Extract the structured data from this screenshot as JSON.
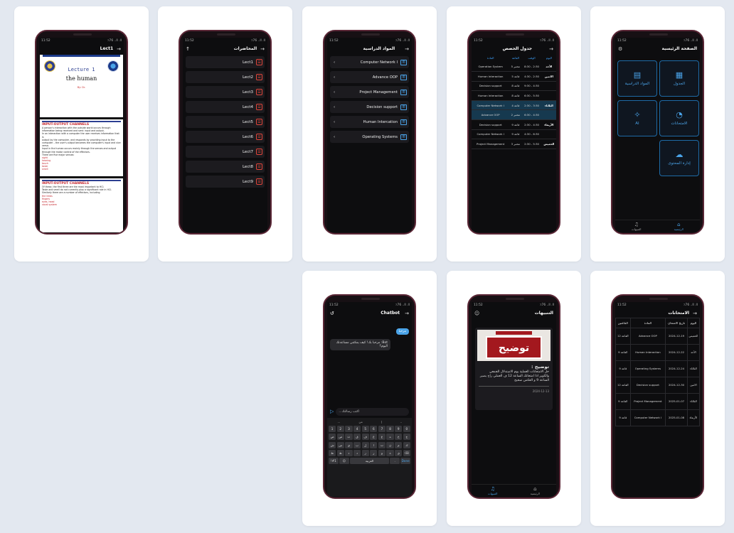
{
  "status": {
    "time": "11:52",
    "net": "٪76 ..ll .ll"
  },
  "lecture_view": {
    "title": "Lect1",
    "cover_title": "Lecture 1",
    "cover_sub": "the human",
    "cover_note": "By: Dr.",
    "slide1_heading": "INPUT-OUTPUT CHANNELS",
    "slide1_lines": [
      "A person's interaction with the outside world occurs through",
      "information being received and sent: input and output.",
      "In an interaction with a computer the user receives information that is",
      "output by the computer, and responds by providing input to the",
      "computer – the user's output becomes the computer's input and vice versa.",
      "Input in the human occurs mainly through the senses and output",
      "through the motor control of the effectors.",
      "There are five major senses:"
    ],
    "slide1_red": [
      "sight",
      "hearing",
      "touch",
      "taste",
      "smell"
    ],
    "slide2_heading": "INPUT-OUTPUT CHANNELS",
    "slide2_lines": [
      "Of these, the first three are the most important to HCI.",
      "Taste and smell do not currently play a significant role in HCI.",
      "Similarly there are a number of effectors, including"
    ],
    "slide2_red": [
      "the limbs",
      "fingers",
      "eyes, head",
      "vocal system"
    ]
  },
  "lectures_list": {
    "title": "المحاضرات",
    "items": [
      "Lect1",
      "Lect2",
      "Lect3",
      "Lect4",
      "Lect5",
      "Lect6",
      "Lect7",
      "Lect8",
      "Lect9"
    ]
  },
  "subjects": {
    "title": "المواد الدراسية",
    "items": [
      "Computer Network I",
      "Advance OOP",
      "Project Management",
      "Decision support",
      "Human Intercation",
      "Operating Systems"
    ]
  },
  "schedule": {
    "title": "جدول الحصص",
    "headers": [
      "اليوم",
      "الوقت",
      "القاعة",
      "المادة"
    ],
    "rows": [
      {
        "day": "الأحد",
        "time": "8:30 - 2:30",
        "room": "مختبر 5",
        "subject": "Operation System",
        "hl": false
      },
      {
        "day": "الاثنين",
        "time": "4:30 - 2:30",
        "room": "قاعة 5",
        "subject": "Human Interaction",
        "hl": false
      },
      {
        "day": "",
        "time": "9:30 - 4:30",
        "room": "قاعة 8",
        "subject": "Decision support",
        "hl": false
      },
      {
        "day": "",
        "time": "6:30 - 5:30",
        "room": "قاعة 8",
        "subject": "Human Interaction",
        "hl": false
      },
      {
        "day": "الثلاثاء",
        "time": "2:30 - 3:30",
        "room": "قاعة 4",
        "subject": "Computer Network I",
        "hl": true
      },
      {
        "day": "",
        "time": "6:30 - 4:30",
        "room": "مختبر 2",
        "subject": "Advance OOP",
        "hl": true
      },
      {
        "day": "الأربعاء",
        "time": "2:30 - 4:30",
        "room": "قاعة 9",
        "subject": "Decision support",
        "hl": false
      },
      {
        "day": "",
        "time": "4:30 - 6:30",
        "room": "قاعة 9",
        "subject": "Computer Network I",
        "hl": false
      },
      {
        "day": "الخميس",
        "time": "2:30 - 5:30",
        "room": "مختبر 3",
        "subject": "Project Management",
        "hl": false
      }
    ]
  },
  "home": {
    "title": "الصفحة الرئيسية",
    "tiles": {
      "schedule": "الجدول",
      "subjects": "المواد الدراسية",
      "exams": "الامتحانات",
      "ai": "AI",
      "content": "إدارة المحتوى"
    },
    "nav": {
      "home": "الرئيسية",
      "notifications": "التنبيهات"
    }
  },
  "chatbot": {
    "title": "Chatbot",
    "user_msg": "مرحبا",
    "bot_msg": "Bot: مرحبا بك! كيف يمكنني مساعدتك اليوم؟",
    "input_placeholder": "اكتب رسالتك...",
    "suggestions": [
      "ـ",
      "إ",
      "من",
      "..."
    ],
    "keys_row1": [
      "1",
      "2",
      "3",
      "4",
      "5",
      "6",
      "7",
      "8",
      "9",
      "0"
    ],
    "keys_row2": [
      "ض",
      "ص",
      "ث",
      "ق",
      "ف",
      "غ",
      "ع",
      "ه",
      "خ",
      "ح"
    ],
    "keys_row3": [
      "ش",
      "س",
      "ي",
      "ب",
      "ل",
      "ا",
      "ت",
      "ن",
      "م",
      "ك"
    ],
    "keys_row4": [
      "ظ",
      "ط",
      "ذ",
      "د",
      "ز",
      "ر",
      "و",
      "ة",
      "ى",
      "⌫"
    ],
    "space_label": "العربية",
    "sym_label": "!#1",
    "done_label": "Done"
  },
  "notifications": {
    "title": "التنبيهات",
    "sign_text": "توضيح",
    "heading": "توضيح :",
    "body": "حل الامتحانات العملية يوم الاستدلال الجمعي والكويز اذا امتحانك الساعة 12 ف العملي راح يصير الساعة 9 و العكس صحيح",
    "date": "2024-12-13",
    "nav": {
      "notifications": "التنبيهات",
      "home": "الرئيسية"
    }
  },
  "exams": {
    "title": "الامتحانات",
    "headers": [
      "اليوم",
      "تاريخ الامتحان",
      "المادة",
      "القاعتين"
    ],
    "rows": [
      {
        "day": "الخميس",
        "date": "2024-12-19",
        "subject": "Advance OOP",
        "room": "القاعة 12"
      },
      {
        "day": "الأحد",
        "date": "2024-12-22",
        "subject": "Human Interaction",
        "room": "القاعة 9"
      },
      {
        "day": "الثلاثاء",
        "date": "2024-12-24",
        "subject": "Operating Systems",
        "room": "قاعة 9"
      },
      {
        "day": "الاثنين",
        "date": "2024-12-30",
        "subject": "Decision support",
        "room": "القاعة 12"
      },
      {
        "day": "الثلاثاء",
        "date": "2025-01-07",
        "subject": "Project Management",
        "room": "القاعة 9"
      },
      {
        "day": "الأربعاء",
        "date": "2025-01-08",
        "subject": "Computer Network I",
        "room": "قاعة 9"
      }
    ]
  },
  "colors": {
    "accent": "#4aa3e8",
    "danger": "#e0453a",
    "frame": "#5a2736"
  }
}
